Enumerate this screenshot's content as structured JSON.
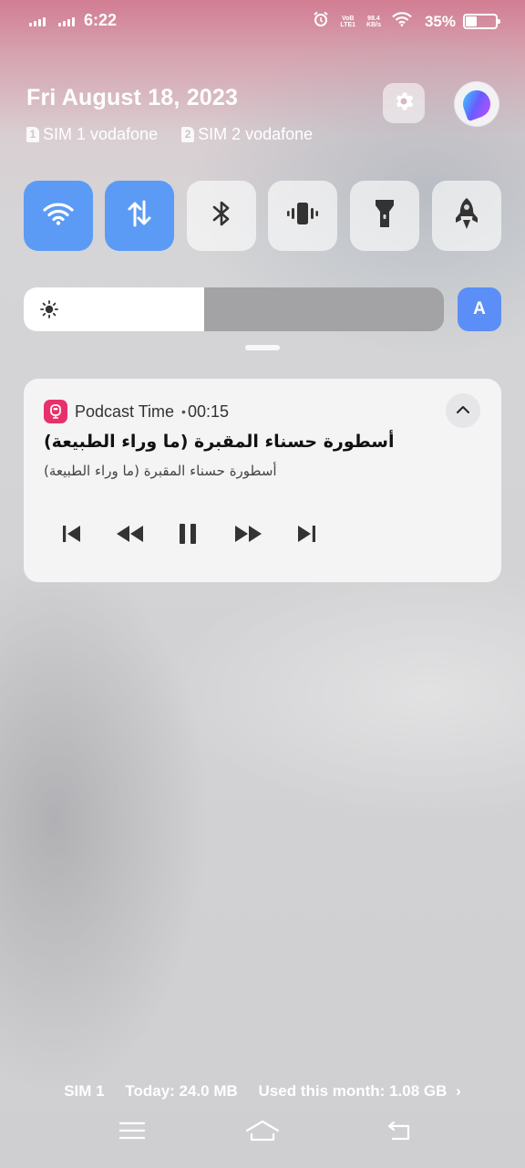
{
  "status_bar": {
    "time": "6:22",
    "lte_top": "VoB",
    "lte_bottom": "LTE1",
    "net_speed": "98.4",
    "net_unit": "KB/s",
    "battery": "35%",
    "battery_level": 0.35
  },
  "header": {
    "date": "Fri August 18, 2023",
    "sim1": {
      "badge": "1",
      "label": "SIM 1 vodafone"
    },
    "sim2": {
      "badge": "2",
      "label": "SIM 2 vodafone"
    }
  },
  "quick_tiles": [
    {
      "icon": "wifi-icon",
      "state": "on"
    },
    {
      "icon": "mobile-data-icon",
      "state": "on"
    },
    {
      "icon": "bluetooth-icon",
      "state": "off"
    },
    {
      "icon": "vibrate-icon",
      "state": "off"
    },
    {
      "icon": "flashlight-icon",
      "state": "off"
    },
    {
      "icon": "rocket-icon",
      "state": "off"
    }
  ],
  "brightness": {
    "level": 0.43,
    "auto_label": "A"
  },
  "notification": {
    "app_name": "Podcast Time",
    "separator": "•",
    "elapsed": "00:15",
    "title": "أسطورة حسناء المقبرة (ما وراء الطبيعة)",
    "subtitle": "أسطورة حسناء المقبرة (ما وراء الطبيعة)",
    "controls": [
      "skip-previous-icon",
      "rewind-icon",
      "pause-icon",
      "fast-forward-icon",
      "skip-next-icon"
    ]
  },
  "data_usage": {
    "sim": "SIM 1",
    "today": "Today: 24.0 MB",
    "month": "Used this month: 1.08 GB",
    "arrow": "›"
  },
  "colors": {
    "accent": "#5b9bf5",
    "auto_button": "#5b8ff7",
    "app_icon": "#e8316a"
  }
}
